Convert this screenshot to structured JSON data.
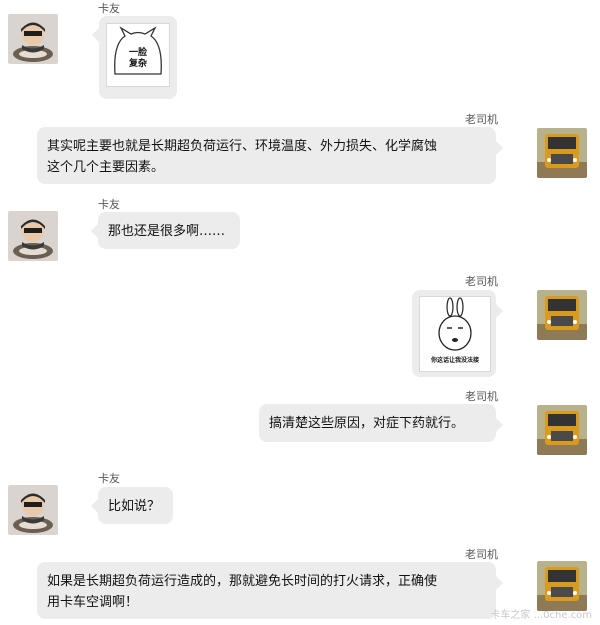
{
  "participants": {
    "left_name": "卡友",
    "right_name": "老司机"
  },
  "messages": [
    {
      "sender": "卡友",
      "type": "sticker",
      "sticker_text_1": "一脸",
      "sticker_text_2": "复杂"
    },
    {
      "sender": "老司机",
      "type": "text",
      "text_line1": "其实呢主要也就是长期超负荷运行、环境温度、外力损失、化学腐蚀",
      "text_line2": "这个几个主要因素。"
    },
    {
      "sender": "卡友",
      "type": "text",
      "text": "那也还是很多啊……"
    },
    {
      "sender": "老司机",
      "type": "sticker",
      "sticker_caption": "你这话让我没法接"
    },
    {
      "sender": "老司机",
      "type": "text",
      "text": "搞清楚这些原因，对症下药就行。"
    },
    {
      "sender": "卡友",
      "type": "text",
      "text": "比如说？"
    },
    {
      "sender": "老司机",
      "type": "text",
      "text_line1": "如果是长期超负荷运行造成的，那就避免长时间的打火请求，正确使",
      "text_line2": "用卡车空调啊！"
    }
  ],
  "watermark": "卡车之家 ...0che.com",
  "icons": {
    "left_avatar": "driver-avatar-icon",
    "right_avatar": "truck-avatar-icon"
  }
}
